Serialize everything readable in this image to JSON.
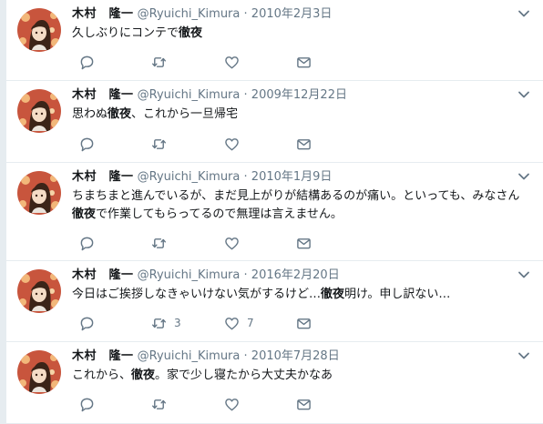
{
  "tweets": [
    {
      "name": "木村　隆一",
      "handle": "@Ryuichi_Kimura",
      "dot": "·",
      "date": "2010年2月3日",
      "text_parts": [
        {
          "t": "久しぶりにコンテで"
        },
        {
          "t": "徹夜",
          "b": true
        }
      ],
      "retweets": "",
      "likes": ""
    },
    {
      "name": "木村　隆一",
      "handle": "@Ryuichi_Kimura",
      "dot": "·",
      "date": "2009年12月22日",
      "text_parts": [
        {
          "t": "思わぬ"
        },
        {
          "t": "徹夜",
          "b": true
        },
        {
          "t": "、これから一旦帰宅"
        }
      ],
      "retweets": "",
      "likes": ""
    },
    {
      "name": "木村　隆一",
      "handle": "@Ryuichi_Kimura",
      "dot": "·",
      "date": "2010年1月9日",
      "text_parts": [
        {
          "t": "ちまちまと進んでいるが、まだ見上がりが結構あるのが痛い。といっても、みなさん"
        },
        {
          "t": "徹夜",
          "b": true
        },
        {
          "t": "で作業してもらってるので無理は言えません。"
        }
      ],
      "retweets": "",
      "likes": ""
    },
    {
      "name": "木村　隆一",
      "handle": "@Ryuichi_Kimura",
      "dot": "·",
      "date": "2016年2月20日",
      "text_parts": [
        {
          "t": "今日はご挨拶しなきゃいけない気がするけど…"
        },
        {
          "t": "徹夜",
          "b": true
        },
        {
          "t": "明け。申し訳ない…"
        }
      ],
      "retweets": "3",
      "likes": "7"
    },
    {
      "name": "木村　隆一",
      "handle": "@Ryuichi_Kimura",
      "dot": "·",
      "date": "2010年7月28日",
      "text_parts": [
        {
          "t": "これから、"
        },
        {
          "t": "徹夜",
          "b": true
        },
        {
          "t": "。家で少し寝たから大丈夫かなあ"
        }
      ],
      "retweets": "",
      "likes": ""
    }
  ],
  "colors": {
    "text": "#14171a",
    "muted": "#657786",
    "border": "#e6ecf0",
    "background": "#ffffff"
  },
  "icons": [
    "avatar",
    "chevron-down-icon",
    "reply-icon",
    "retweet-icon",
    "like-icon",
    "message-icon"
  ]
}
